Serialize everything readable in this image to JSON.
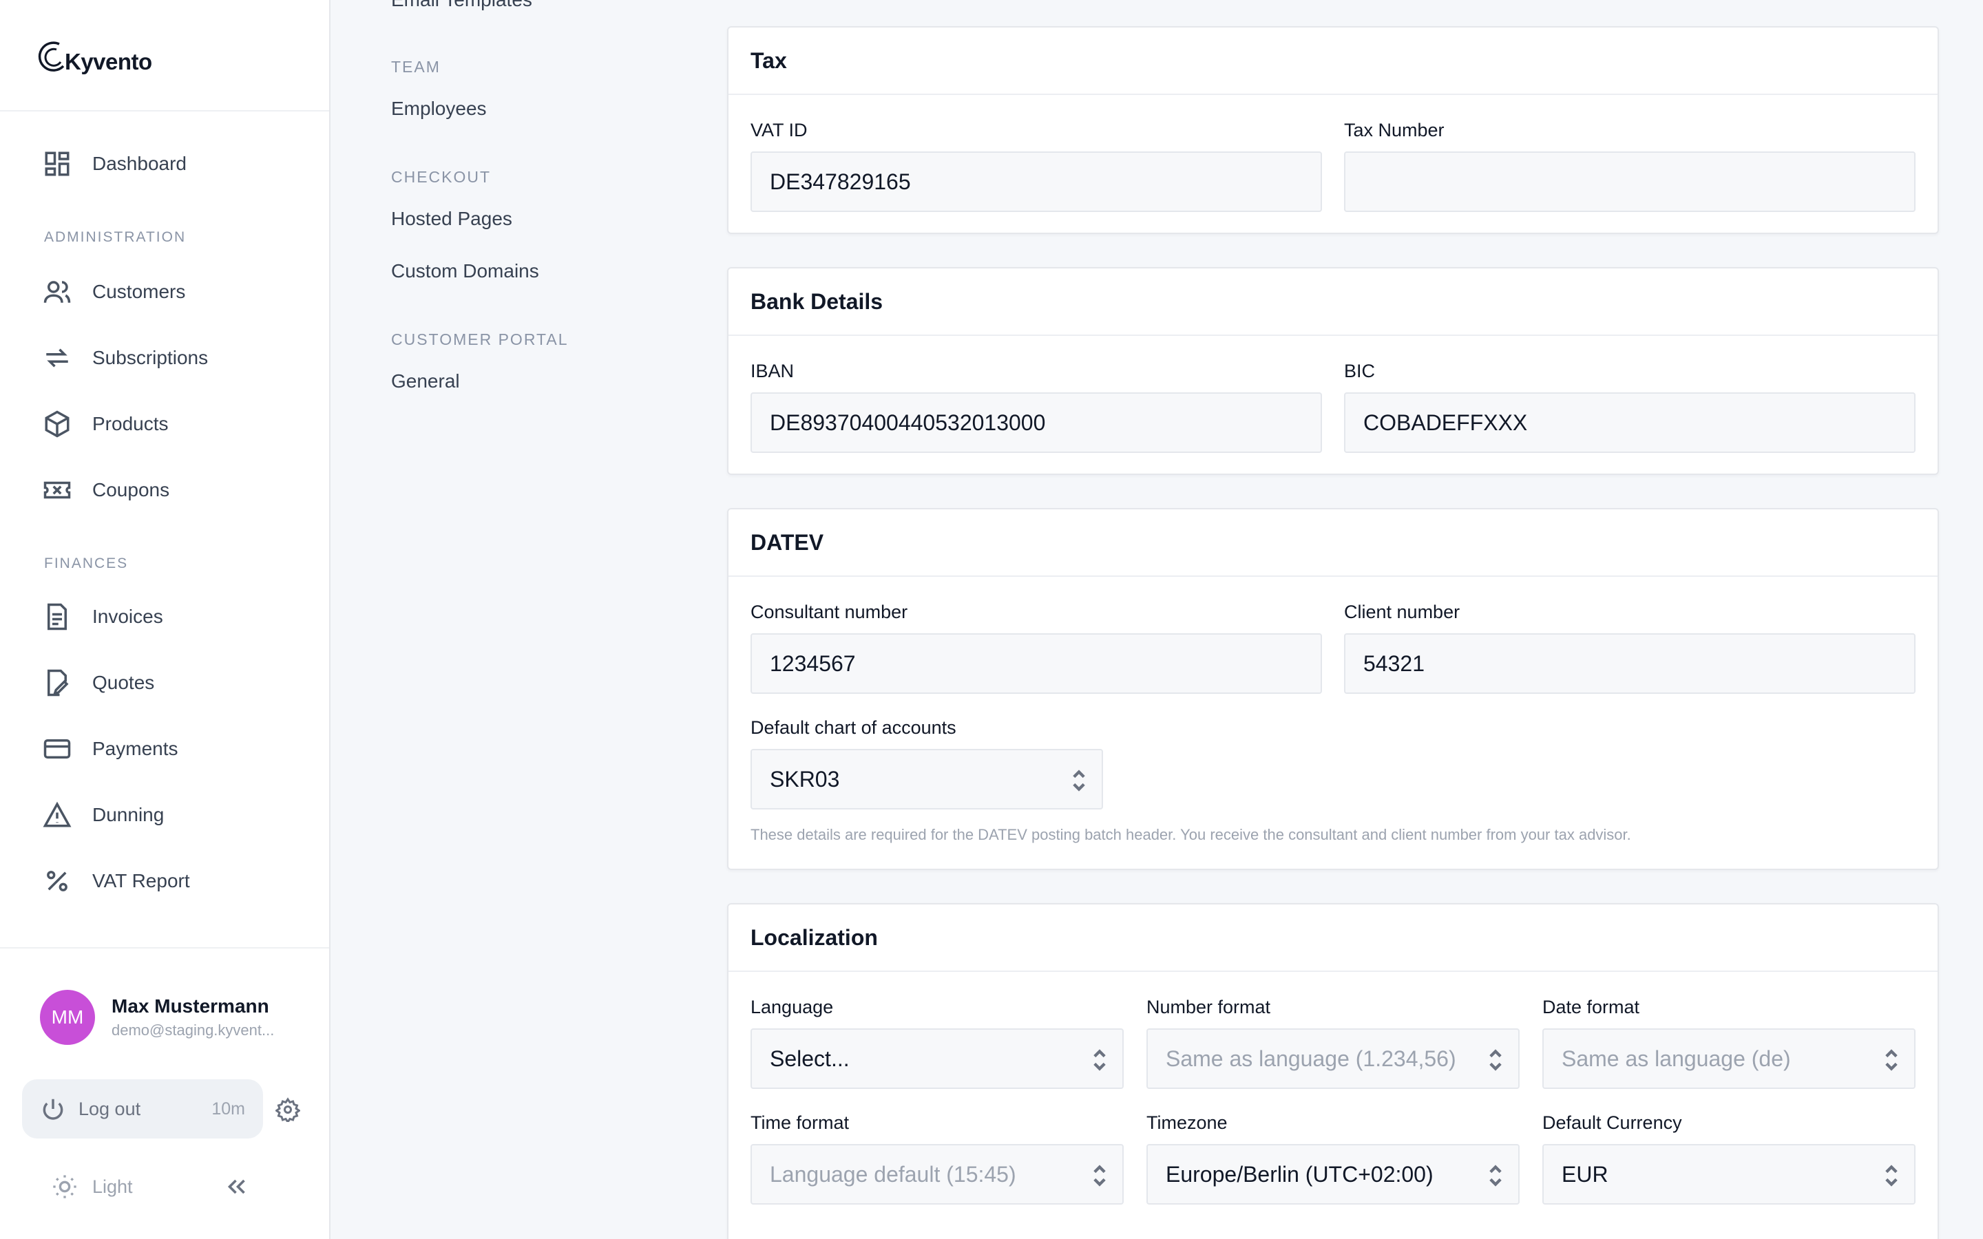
{
  "brand": {
    "name": "Kyvento",
    "accent": "#c84fd8"
  },
  "sidebar": {
    "dashboard": "Dashboard",
    "sections": {
      "administration": "ADMINISTRATION",
      "finances": "FINANCES"
    },
    "admin_items": [
      "Customers",
      "Subscriptions",
      "Products",
      "Coupons"
    ],
    "finance_items": [
      "Invoices",
      "Quotes",
      "Payments",
      "Dunning",
      "VAT Report"
    ],
    "user": {
      "initials": "MM",
      "name": "Max Mustermann",
      "email": "demo@staging.kyvent..."
    },
    "logout": {
      "label": "Log out",
      "timer": "10m"
    },
    "theme": "Light"
  },
  "subnav": {
    "cut_item": "Email Templates",
    "team": {
      "title": "TEAM",
      "items": [
        "Employees"
      ]
    },
    "checkout": {
      "title": "CHECKOUT",
      "items": [
        "Hosted Pages",
        "Custom Domains"
      ]
    },
    "portal": {
      "title": "CUSTOMER PORTAL",
      "items": [
        "General"
      ]
    }
  },
  "tax": {
    "title": "Tax",
    "vat_label": "VAT ID",
    "vat_value": "DE347829165",
    "taxnum_label": "Tax Number",
    "taxnum_value": ""
  },
  "bank": {
    "title": "Bank Details",
    "iban_label": "IBAN",
    "iban_value": "DE89370400440532013000",
    "bic_label": "BIC",
    "bic_value": "COBADEFFXXX"
  },
  "datev": {
    "title": "DATEV",
    "consultant_label": "Consultant number",
    "consultant_value": "1234567",
    "client_label": "Client number",
    "client_value": "54321",
    "chart_label": "Default chart of accounts",
    "chart_value": "SKR03",
    "hint": "These details are required for the DATEV posting batch header. You receive the consultant and client number from your tax advisor."
  },
  "localization": {
    "title": "Localization",
    "language_label": "Language",
    "language_value": "Select...",
    "number_label": "Number format",
    "number_value": "Same as language (1.234,56)",
    "date_label": "Date format",
    "date_value": "Same as language (de)",
    "time_label": "Time format",
    "time_value": "Language default (15:45)",
    "timezone_label": "Timezone",
    "timezone_value": "Europe/Berlin (UTC+02:00)",
    "currency_label": "Default Currency",
    "currency_value": "EUR"
  }
}
